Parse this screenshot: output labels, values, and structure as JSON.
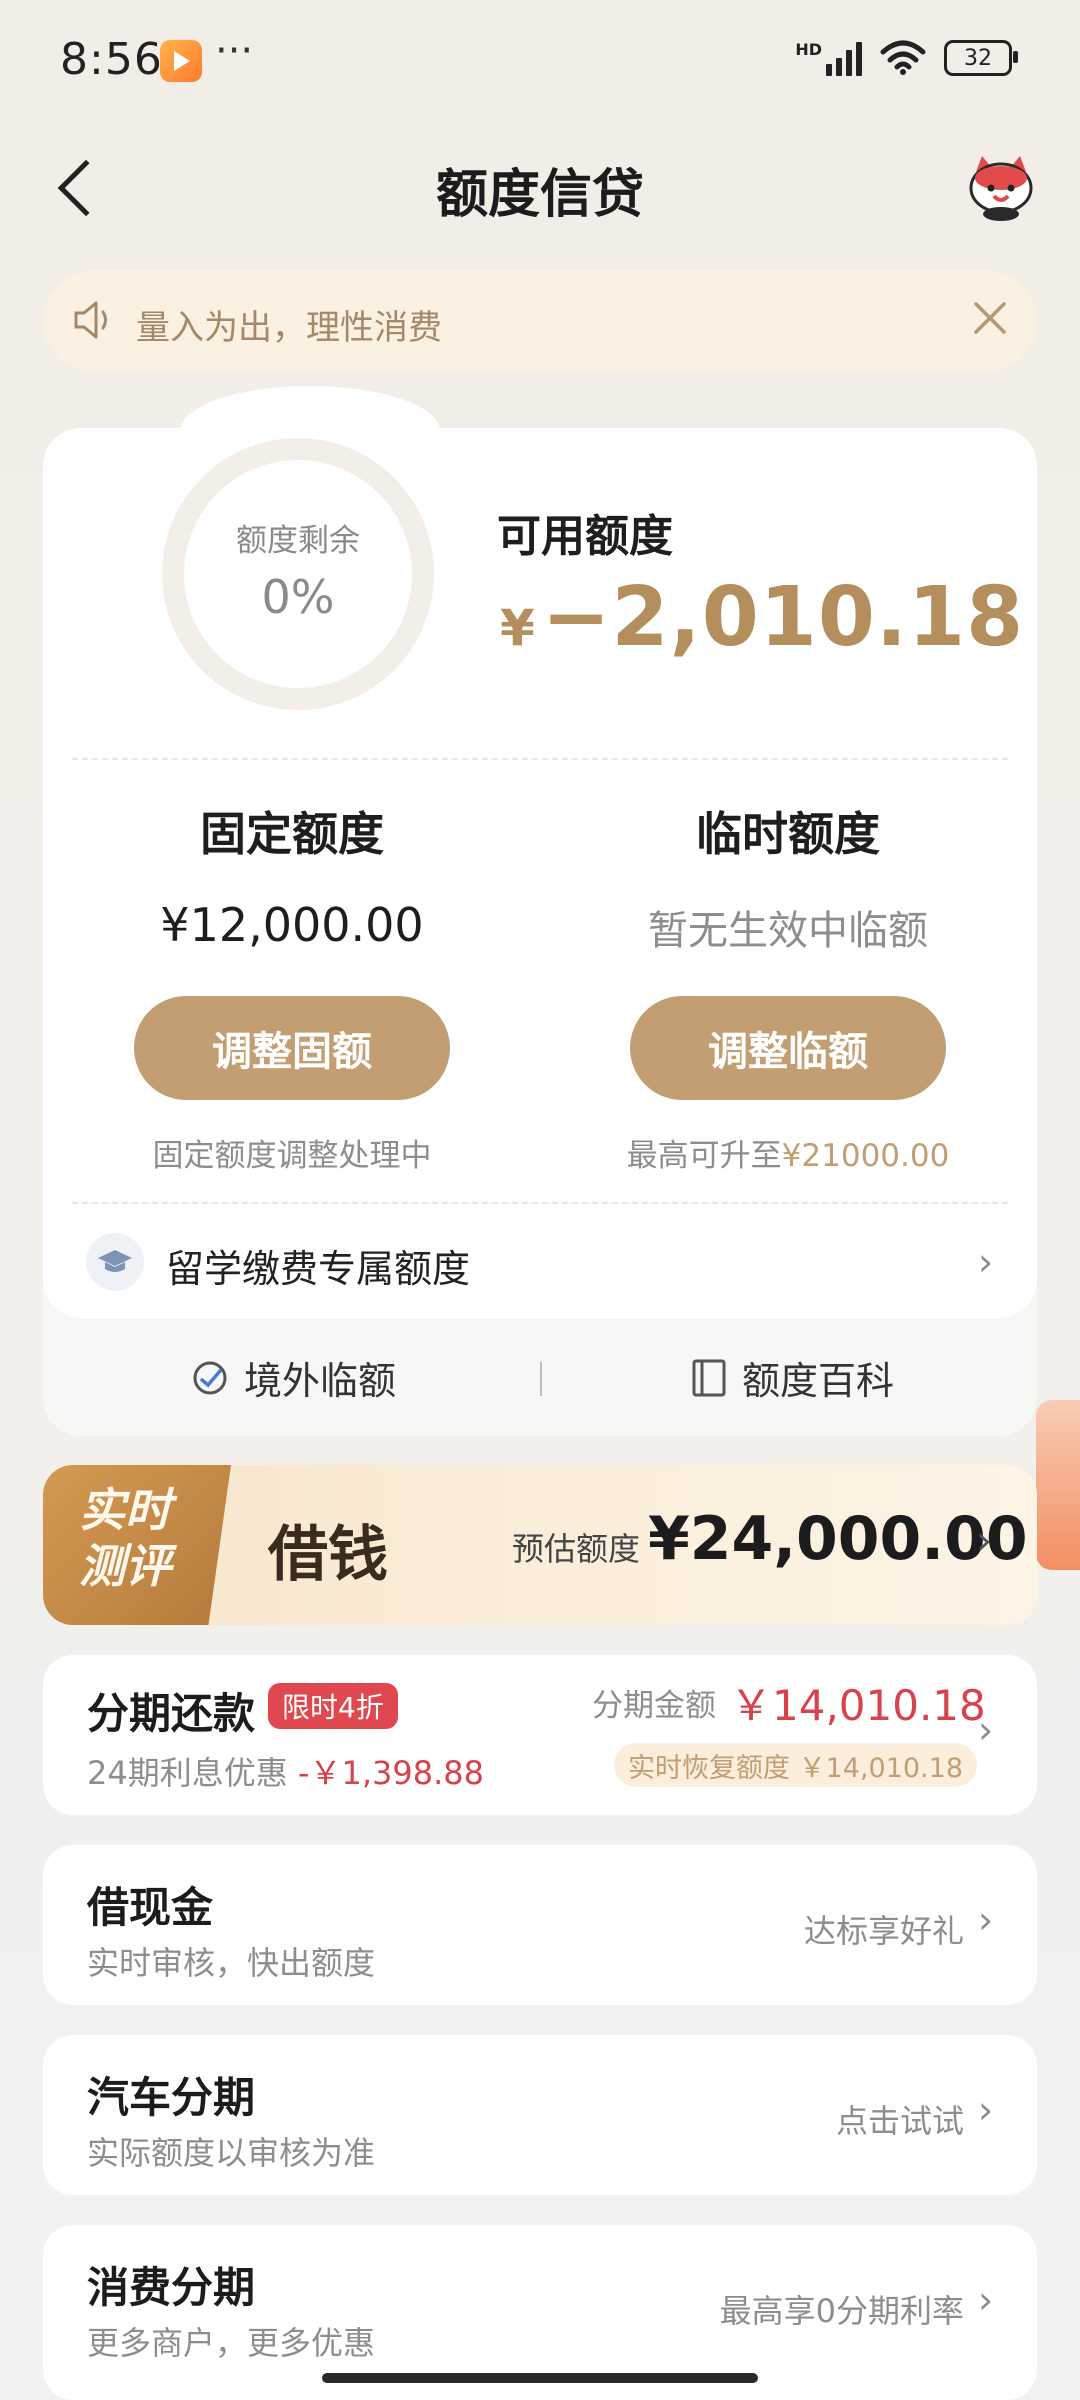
{
  "status_bar": {
    "time": "8:56",
    "dots": "···",
    "battery": "32"
  },
  "header": {
    "title": "额度信贷"
  },
  "notice": {
    "text": "量入为出，理性消费"
  },
  "quota": {
    "remaining_label": "额度剩余",
    "remaining_percent": "0%",
    "available_label": "可用额度",
    "available_currency": "¥",
    "available_amount": "−2,010.18",
    "fixed": {
      "title": "固定额度",
      "amount": "¥12,000.00",
      "button": "调整固额",
      "note": "固定额度调整处理中"
    },
    "temporary": {
      "title": "临时额度",
      "status": "暂无生效中临额",
      "button": "调整临额",
      "note_prefix": "最高可升至",
      "note_amount": "¥21000.00"
    },
    "study_label": "留学缴费专属额度",
    "overseas_label": "境外临额",
    "encyclopedia_label": "额度百科"
  },
  "borrow_banner": {
    "badge_line1": "实时",
    "badge_line2": "测评",
    "title": "借钱",
    "estimate_label": "预估额度",
    "estimate_amount": "¥24,000.00"
  },
  "installment": {
    "title": "分期还款",
    "tag": "限时4折",
    "sub_prefix": "24期利息优惠",
    "sub_discount": "-￥1,398.88",
    "amount_label": "分期金额",
    "amount": "￥14,010.18",
    "restore_label": "实时恢复额度 ￥14,010.18"
  },
  "cash_loan": {
    "title": "借现金",
    "subtitle": "实时审核，快出额度",
    "right": "达标享好礼"
  },
  "auto_installment": {
    "title": "汽车分期",
    "subtitle": "实际额度以审核为准",
    "right": "点击试试"
  },
  "consumer_installment": {
    "title": "消费分期",
    "subtitle": "更多商户，更多优惠",
    "right": "最高享0分期利率"
  },
  "colors": {
    "accent_gold": "#c29e72",
    "red": "#d7424b",
    "banner_orange": "#b57a3c"
  },
  "icons": [
    "back-arrow-icon",
    "mascot-icon",
    "speaker-icon",
    "close-icon",
    "graduation-cap-icon",
    "chevron-right-icon",
    "globe-refresh-icon",
    "book-icon"
  ]
}
